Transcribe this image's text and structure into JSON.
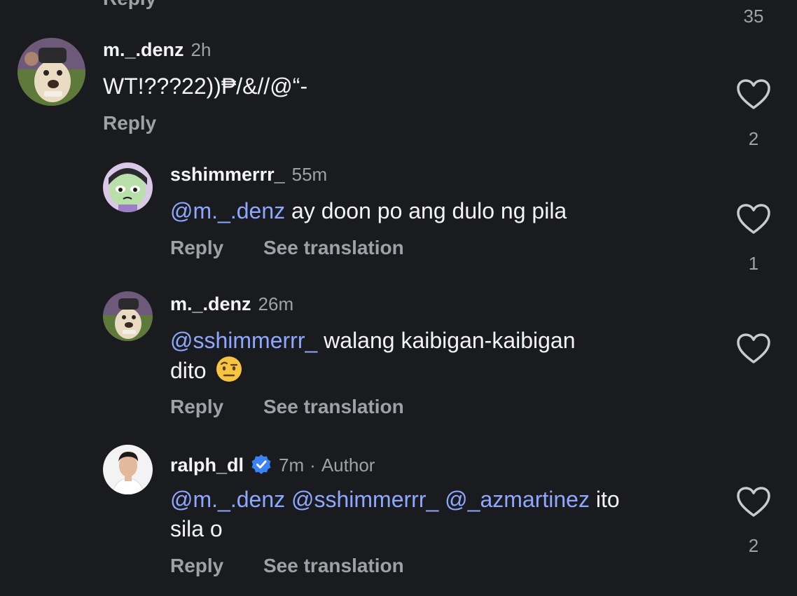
{
  "top": {
    "reply_label": "Reply",
    "like_count": "35"
  },
  "comments": [
    {
      "username": "m._.denz",
      "time": "2h",
      "text": "WT!???22))₱/&//@“-",
      "reply_label": "Reply",
      "like_count": "2"
    },
    {
      "username": "sshimmerrr_",
      "time": "55m",
      "mention": "@m._.denz",
      "text": " ay doon po ang dulo ng pila",
      "reply_label": "Reply",
      "translate_label": "See translation",
      "like_count": "1"
    },
    {
      "username": "m._.denz",
      "time": "26m",
      "mention": "@sshimmerrr_",
      "text_line1": " walang kaibigan-kaibigan",
      "text_line2": "dito ",
      "emoji": "raised-eyebrow-emoji",
      "reply_label": "Reply",
      "translate_label": "See translation"
    },
    {
      "username": "ralph_dl",
      "time": "7m",
      "separator": "·",
      "badge": "Author",
      "mention1": "@m._.denz",
      "mention2": "@sshimmerrr_",
      "mention3": "@_azmartinez",
      "text_line1": " ito",
      "text_line2": "sila o",
      "reply_label": "Reply",
      "translate_label": "See translation",
      "like_count": "2"
    }
  ],
  "colors": {
    "background": "#1a1b1f",
    "mention": "#8ea7ff",
    "secondary_text": "#9fa1a6",
    "verified": "#3b82f6"
  },
  "icons": {
    "like": "heart-icon",
    "verified": "verified-badge-icon"
  }
}
